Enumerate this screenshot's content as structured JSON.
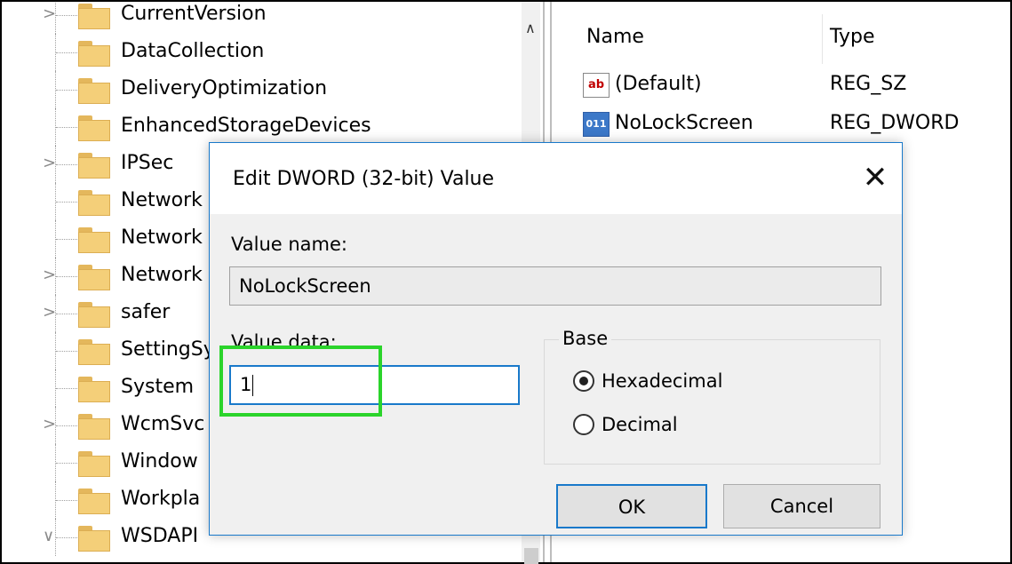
{
  "tree": {
    "items": [
      {
        "label": "CurrentVersion",
        "expandable": true
      },
      {
        "label": "DataCollection",
        "expandable": false
      },
      {
        "label": "DeliveryOptimization",
        "expandable": false
      },
      {
        "label": "EnhancedStorageDevices",
        "expandable": false
      },
      {
        "label": "IPSec",
        "expandable": true
      },
      {
        "label": "Network",
        "expandable": false
      },
      {
        "label": "Network",
        "expandable": false
      },
      {
        "label": "Network",
        "expandable": true
      },
      {
        "label": "safer",
        "expandable": true
      },
      {
        "label": "SettingSy",
        "expandable": false
      },
      {
        "label": "System",
        "expandable": false
      },
      {
        "label": "WcmSvc",
        "expandable": true
      },
      {
        "label": "Window",
        "expandable": false
      },
      {
        "label": "Workpla",
        "expandable": false
      },
      {
        "label": "WSDAPI",
        "expandable": true,
        "expanded": true
      }
    ],
    "expand_glyph": ">",
    "collapse_glyph": "∨",
    "scroll_up_glyph": "∧"
  },
  "values_pane": {
    "columns": {
      "name": "Name",
      "type": "Type"
    },
    "rows": [
      {
        "icon": "string-value-icon",
        "icon_text": "ab",
        "name": "(Default)",
        "type": "REG_SZ"
      },
      {
        "icon": "binary-value-icon",
        "icon_text": "011",
        "name": "NoLockScreen",
        "type": "REG_DWORD"
      }
    ]
  },
  "dialog": {
    "title": "Edit DWORD (32-bit) Value",
    "close_glyph": "✕",
    "value_name_label": "Value name:",
    "value_name": "NoLockScreen",
    "value_data_label": "Value data:",
    "value_data": "1",
    "base_label": "Base",
    "radio_hex": "Hexadecimal",
    "radio_dec": "Decimal",
    "selected_base": "Hexadecimal",
    "ok_label": "OK",
    "cancel_label": "Cancel",
    "accent_color": "#1979ca",
    "highlight_color": "#2bd42b"
  }
}
